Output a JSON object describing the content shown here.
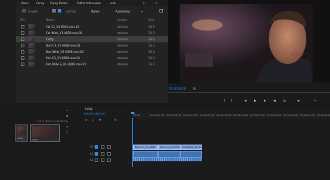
{
  "browser": {
    "breadcrumbs": [
      "Users",
      "Corey",
      "Corey Demo",
      "Editor Interviews",
      "cuts"
    ],
    "toolbar": {
      "view_label": "visuals",
      "sort_label": "sort by",
      "sort_value": "Name",
      "order_value": "Ascending"
    },
    "columns": [
      "File",
      "Name",
      "Creator",
      "Size"
    ],
    "rows": [
      {
        "name": "Cal C1_V1-0010.mov.01",
        "creator": "otelrose",
        "size": "13.3"
      },
      {
        "name": "Cal Wide_V1-0030.mov.01",
        "creator": "otelrose",
        "size": "13.3"
      },
      {
        "name": "Cutty",
        "creator": "otelrose",
        "size": "38.6"
      },
      {
        "name": "Dan C1_V1-0006.mov.01",
        "creator": "otelrose",
        "size": "13.3"
      },
      {
        "name": "Dan Wide_V1-0006.mov.01",
        "creator": "otelrose",
        "size": "13.3"
      },
      {
        "name": "Kim C1_V1-0009.mov.01",
        "creator": "otelrose",
        "size": "13.3"
      },
      {
        "name": "Kim Wide E_V1-0006.mov.01",
        "creator": "otelrose",
        "size": "13.3"
      }
    ],
    "selected_index": 2
  },
  "preview": {
    "timecode": "00:00:00:00",
    "fit_label": "Fit"
  },
  "bin": {
    "items_label": "1 of 1 items selected",
    "clips": [
      "Cutty",
      "Cutty"
    ]
  },
  "timeline": {
    "sequence_name": "Cutty",
    "timecode": "00:00:00:00",
    "ruler": [
      "00:00",
      "00:00:01:00",
      "00:00:02:00",
      "00:00:03:00",
      "00:00:04:00",
      "00:00:05:00",
      "00:00:06:00",
      "00:00:07:00",
      "00:00:08:00",
      "00:00:09:00",
      "00:00:10:00",
      "00:00:11:00"
    ],
    "tracks": [
      "V1",
      "A1",
      "A2"
    ],
    "clips": [
      {
        "label": "Dan C1_V1-0006",
        "row": "V1"
      },
      {
        "label": "Kim C1_V1-0009",
        "row": "V1"
      },
      {
        "label": "Cal Wide_V1-0030",
        "row": "V1"
      }
    ]
  },
  "colors": {
    "accent": "#2d8ceb",
    "clip_video": "#7fa3d6",
    "clip_audio": "#3f74b8"
  }
}
